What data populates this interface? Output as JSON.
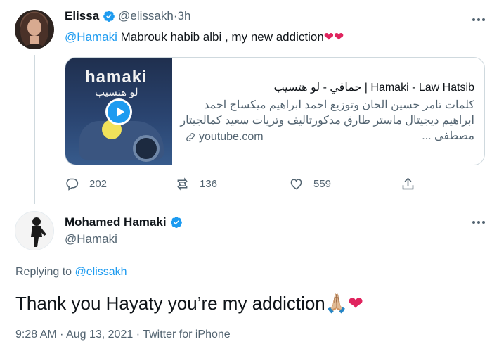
{
  "tweet1": {
    "author_name": "Elissa",
    "handle": "@elissakh",
    "time_sep": " · ",
    "time": "3h",
    "text_mention": "@Hamaki",
    "text_body": " Mabrouk habib albi , my new addiction",
    "text_emoji": "❤❤",
    "card": {
      "thumb_title": "hamaki",
      "thumb_subtitle": "لو هتسيب",
      "title": "حماقي - لو هتسيب | Hamaki - Law Hatsib",
      "description": "كلمات تامر حسين الحان وتوزيع احمد ابراهيم ميكساج احمد ابراهيم ديجيتال ماستر طارق مدكورتاليف وتريات سعيد كمالجيتار مصطفى ...",
      "domain": "youtube.com"
    },
    "replies": "202",
    "retweets": "136",
    "likes": "559"
  },
  "tweet2": {
    "author_name": "Mohamed Hamaki",
    "handle": "@Hamaki",
    "replying_prefix": "Replying to ",
    "replying_handle": "@elissakh",
    "text": "Thank you Hayaty you’re my addiction ",
    "text_emoji": "🙏🏼",
    "text_heart": "❤",
    "time": "9:28 AM",
    "sep1": " · ",
    "date": "Aug 13, 2021",
    "sep2": " · ",
    "source": "Twitter for iPhone"
  },
  "colors": {
    "accent": "#1d9bf0",
    "secondary_text": "#536471",
    "heart": "#e0245e"
  },
  "icons": [
    "verified-badge-icon",
    "more-icon",
    "reply-icon",
    "retweet-icon",
    "like-icon",
    "share-icon",
    "link-icon",
    "play-icon"
  ]
}
